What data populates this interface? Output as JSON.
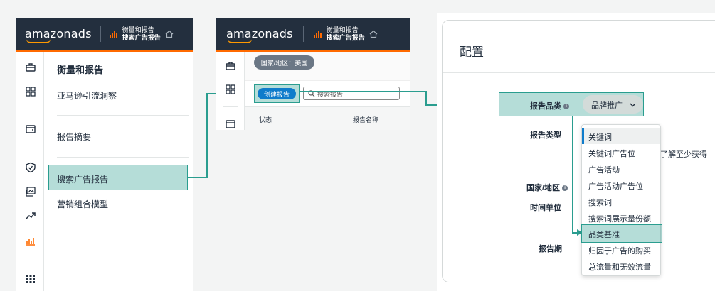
{
  "brand": {
    "logo": "amazonads",
    "accent": "#ff6a00",
    "highlight": "#2a9d8f"
  },
  "panel1": {
    "crumb_top": "衡量和报告",
    "crumb_bottom": "搜索广告报告",
    "menu_title": "衡量和报告",
    "items": [
      "亚马逊引流洞察",
      "报告摘要",
      "搜索广告报告",
      "营销组合模型"
    ]
  },
  "panel2": {
    "crumb_top": "衡量和报告",
    "crumb_bottom": "搜索广告报告",
    "country_filter": "国家/地区：美国",
    "create_button": "创建报告",
    "search_placeholder": "搜索报告",
    "columns": [
      "状态",
      "报告名称"
    ]
  },
  "panel3": {
    "title": "配置",
    "labels": {
      "category": "报告品类",
      "type": "报告类型",
      "country": "国家/地区",
      "time_unit": "时间单位",
      "period": "报告期"
    },
    "category_value": "品牌推广",
    "partial_text": "了解至少获得",
    "options": [
      "关键词",
      "关键词广告位",
      "广告活动",
      "广告活动广告位",
      "搜索词",
      "搜索词展示量份额",
      "品类基准",
      "归因于广告的购买",
      "总流量和无效流量"
    ]
  }
}
